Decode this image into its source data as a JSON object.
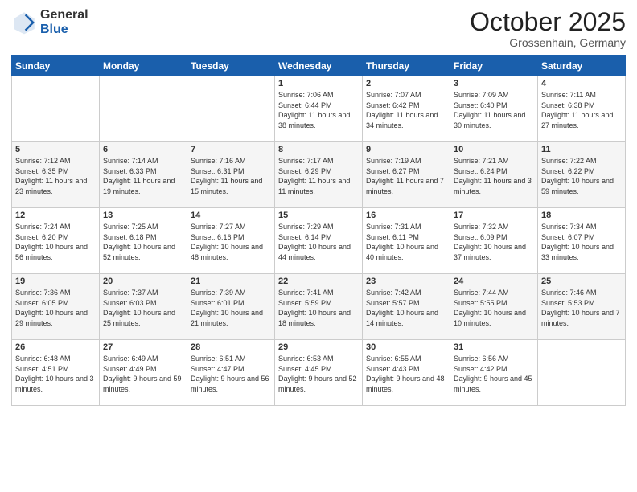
{
  "header": {
    "logo_general": "General",
    "logo_blue": "Blue",
    "month_title": "October 2025",
    "subtitle": "Grossenhain, Germany"
  },
  "days_of_week": [
    "Sunday",
    "Monday",
    "Tuesday",
    "Wednesday",
    "Thursday",
    "Friday",
    "Saturday"
  ],
  "weeks": [
    [
      {
        "day": "",
        "info": ""
      },
      {
        "day": "",
        "info": ""
      },
      {
        "day": "",
        "info": ""
      },
      {
        "day": "1",
        "info": "Sunrise: 7:06 AM\nSunset: 6:44 PM\nDaylight: 11 hours\nand 38 minutes."
      },
      {
        "day": "2",
        "info": "Sunrise: 7:07 AM\nSunset: 6:42 PM\nDaylight: 11 hours\nand 34 minutes."
      },
      {
        "day": "3",
        "info": "Sunrise: 7:09 AM\nSunset: 6:40 PM\nDaylight: 11 hours\nand 30 minutes."
      },
      {
        "day": "4",
        "info": "Sunrise: 7:11 AM\nSunset: 6:38 PM\nDaylight: 11 hours\nand 27 minutes."
      }
    ],
    [
      {
        "day": "5",
        "info": "Sunrise: 7:12 AM\nSunset: 6:35 PM\nDaylight: 11 hours\nand 23 minutes."
      },
      {
        "day": "6",
        "info": "Sunrise: 7:14 AM\nSunset: 6:33 PM\nDaylight: 11 hours\nand 19 minutes."
      },
      {
        "day": "7",
        "info": "Sunrise: 7:16 AM\nSunset: 6:31 PM\nDaylight: 11 hours\nand 15 minutes."
      },
      {
        "day": "8",
        "info": "Sunrise: 7:17 AM\nSunset: 6:29 PM\nDaylight: 11 hours\nand 11 minutes."
      },
      {
        "day": "9",
        "info": "Sunrise: 7:19 AM\nSunset: 6:27 PM\nDaylight: 11 hours\nand 7 minutes."
      },
      {
        "day": "10",
        "info": "Sunrise: 7:21 AM\nSunset: 6:24 PM\nDaylight: 11 hours\nand 3 minutes."
      },
      {
        "day": "11",
        "info": "Sunrise: 7:22 AM\nSunset: 6:22 PM\nDaylight: 10 hours\nand 59 minutes."
      }
    ],
    [
      {
        "day": "12",
        "info": "Sunrise: 7:24 AM\nSunset: 6:20 PM\nDaylight: 10 hours\nand 56 minutes."
      },
      {
        "day": "13",
        "info": "Sunrise: 7:25 AM\nSunset: 6:18 PM\nDaylight: 10 hours\nand 52 minutes."
      },
      {
        "day": "14",
        "info": "Sunrise: 7:27 AM\nSunset: 6:16 PM\nDaylight: 10 hours\nand 48 minutes."
      },
      {
        "day": "15",
        "info": "Sunrise: 7:29 AM\nSunset: 6:14 PM\nDaylight: 10 hours\nand 44 minutes."
      },
      {
        "day": "16",
        "info": "Sunrise: 7:31 AM\nSunset: 6:11 PM\nDaylight: 10 hours\nand 40 minutes."
      },
      {
        "day": "17",
        "info": "Sunrise: 7:32 AM\nSunset: 6:09 PM\nDaylight: 10 hours\nand 37 minutes."
      },
      {
        "day": "18",
        "info": "Sunrise: 7:34 AM\nSunset: 6:07 PM\nDaylight: 10 hours\nand 33 minutes."
      }
    ],
    [
      {
        "day": "19",
        "info": "Sunrise: 7:36 AM\nSunset: 6:05 PM\nDaylight: 10 hours\nand 29 minutes."
      },
      {
        "day": "20",
        "info": "Sunrise: 7:37 AM\nSunset: 6:03 PM\nDaylight: 10 hours\nand 25 minutes."
      },
      {
        "day": "21",
        "info": "Sunrise: 7:39 AM\nSunset: 6:01 PM\nDaylight: 10 hours\nand 21 minutes."
      },
      {
        "day": "22",
        "info": "Sunrise: 7:41 AM\nSunset: 5:59 PM\nDaylight: 10 hours\nand 18 minutes."
      },
      {
        "day": "23",
        "info": "Sunrise: 7:42 AM\nSunset: 5:57 PM\nDaylight: 10 hours\nand 14 minutes."
      },
      {
        "day": "24",
        "info": "Sunrise: 7:44 AM\nSunset: 5:55 PM\nDaylight: 10 hours\nand 10 minutes."
      },
      {
        "day": "25",
        "info": "Sunrise: 7:46 AM\nSunset: 5:53 PM\nDaylight: 10 hours\nand 7 minutes."
      }
    ],
    [
      {
        "day": "26",
        "info": "Sunrise: 6:48 AM\nSunset: 4:51 PM\nDaylight: 10 hours\nand 3 minutes."
      },
      {
        "day": "27",
        "info": "Sunrise: 6:49 AM\nSunset: 4:49 PM\nDaylight: 9 hours\nand 59 minutes."
      },
      {
        "day": "28",
        "info": "Sunrise: 6:51 AM\nSunset: 4:47 PM\nDaylight: 9 hours\nand 56 minutes."
      },
      {
        "day": "29",
        "info": "Sunrise: 6:53 AM\nSunset: 4:45 PM\nDaylight: 9 hours\nand 52 minutes."
      },
      {
        "day": "30",
        "info": "Sunrise: 6:55 AM\nSunset: 4:43 PM\nDaylight: 9 hours\nand 48 minutes."
      },
      {
        "day": "31",
        "info": "Sunrise: 6:56 AM\nSunset: 4:42 PM\nDaylight: 9 hours\nand 45 minutes."
      },
      {
        "day": "",
        "info": ""
      }
    ]
  ]
}
